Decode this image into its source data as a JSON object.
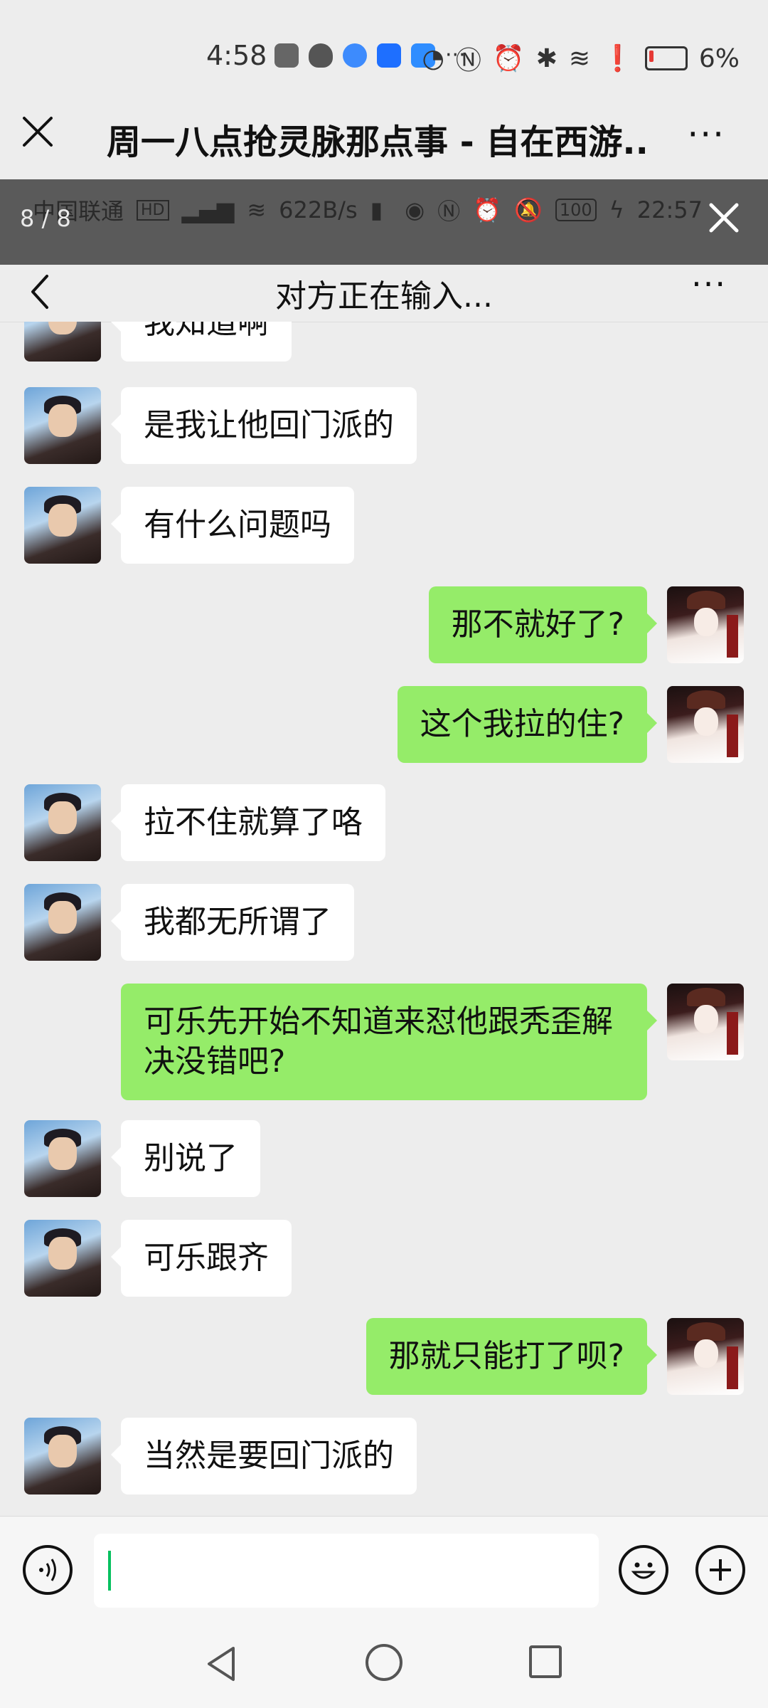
{
  "status_bar": {
    "time": "4:58",
    "battery_percent": "6%",
    "more_glyph": "···"
  },
  "outer_header": {
    "title": "周一八点抢灵脉那点事 - 自在西游...",
    "more_glyph": "···"
  },
  "viewer": {
    "counter": "8 / 8"
  },
  "inner_status_bar": {
    "carrier": "中国联通",
    "speed": "622B/s",
    "battery": "100",
    "time": "22:57"
  },
  "chat": {
    "title": "对方正在输入...",
    "more_glyph": "···"
  },
  "messages": [
    {
      "side": "left",
      "text": "我知道啊"
    },
    {
      "side": "left",
      "text": "是我让他回门派的"
    },
    {
      "side": "left",
      "text": "有什么问题吗"
    },
    {
      "side": "right",
      "text": "那不就好了?"
    },
    {
      "side": "right",
      "text": "这个我拉的住?"
    },
    {
      "side": "left",
      "text": "拉不住就算了咯"
    },
    {
      "side": "left",
      "text": "我都无所谓了"
    },
    {
      "side": "right",
      "text": "可乐先开始不知道来怼他跟秃歪解决没错吧?"
    },
    {
      "side": "left",
      "text": "别说了"
    },
    {
      "side": "left",
      "text": "可乐跟齐"
    },
    {
      "side": "right",
      "text": "那就只能打了呗?"
    },
    {
      "side": "left",
      "text": "当然是要回门派的"
    }
  ],
  "input": {
    "value": "",
    "placeholder": ""
  },
  "colors": {
    "bubble_self": "#95ec69",
    "bubble_other": "#ffffff",
    "background": "#ededed",
    "caret": "#07c160"
  }
}
